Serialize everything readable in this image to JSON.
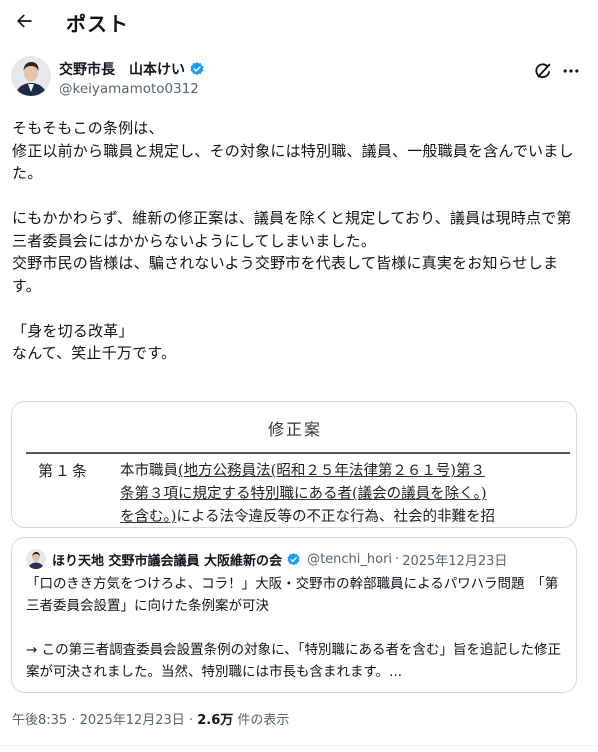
{
  "header": {
    "title": "ポスト"
  },
  "author": {
    "display_name": "交野市長　山本けい",
    "handle": "@keiyamamoto0312"
  },
  "post": {
    "text": "そもそもこの条例は、\n修正以前から職員と規定し、その対象には特別職、議員、一般職員を含んでいました。\n\nにもかかわらず、維新の修正案は、議員を除くと規定しており、議員は現時点で第三者委員会にはかからないようにしてしまいました。\n交野市民の皆様は、騙されないよう交野市を代表して皆様に真実をお知らせします。\n\n「身を切る改革」\nなんて、笑止千万です。"
  },
  "media": {
    "heading": "修正案",
    "article": "第１条",
    "line1_plain": "本市職員",
    "line1_underlined": "(地方公務員法(昭和２５年法律第２６１号)第３",
    "line2_underlined": "条第３項に規定する特別職にある者(議会の議員を除く。)",
    "line3_underlined": "を含む。)",
    "line3_plain": "による法令違反等の不正な行為、社会的非難を招"
  },
  "quote": {
    "name": "ほり天地 交野市議会議員 大阪維新の会",
    "handle": "@tenchi_hori",
    "separator": "·",
    "date": "2025年12月23日",
    "text": "「口のきき方気をつけろよ、コラ！」大阪・交野市の幹部職員によるパワハラ問題　「第三者委員会設置」に向けた条例案が可決\n\n→ この第三者調査委員会設置条例の対象に、「特別職にある者を含む」旨を追記した修正案が可決されました。当然、特別職には市長も含まれます。..."
  },
  "meta": {
    "time": "午後8:35",
    "separator": "·",
    "date": "2025年12月23日",
    "separator2": "·",
    "views_count": "2.6万",
    "views_label": " 件の表示"
  },
  "colors": {
    "text": "#0f1419",
    "secondary": "#536471",
    "verified": "#1d9bf0",
    "border": "#cfd9de"
  }
}
